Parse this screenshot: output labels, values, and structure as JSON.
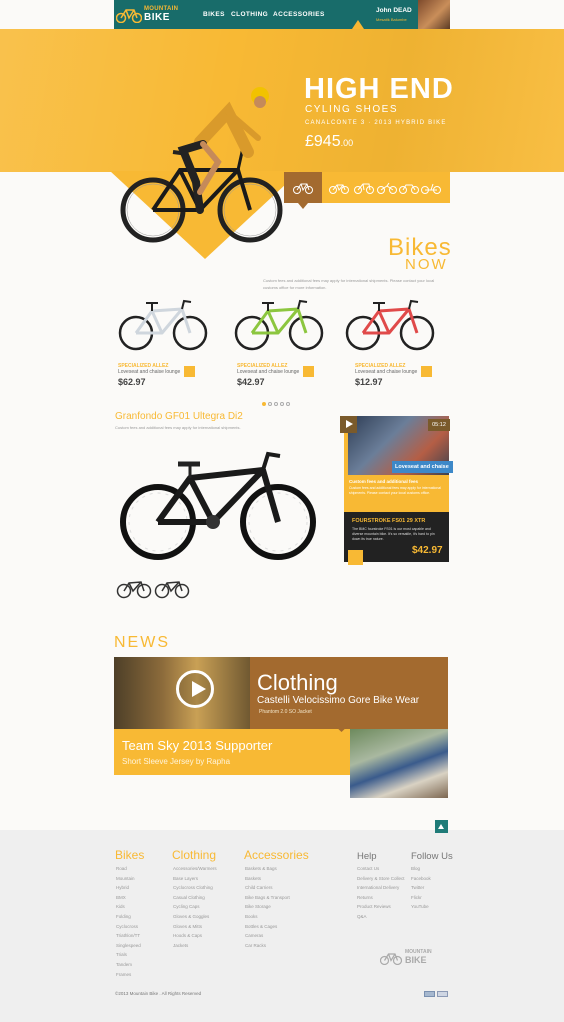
{
  "brand": {
    "line1": "MOUNTAIN",
    "line2": "BIKE"
  },
  "nav": [
    {
      "label": "BIKES"
    },
    {
      "label": "CLOTHING"
    },
    {
      "label": "ACCESSORIES"
    }
  ],
  "user": {
    "name": "John DEAD",
    "subtitle": "Mesatik Balumbe"
  },
  "hero": {
    "title": "HIGH END",
    "subtitle": "CYLING SHOES",
    "model": "CANALCONTE 3 · 2013 HYBRID BIKE",
    "price_main": "£945",
    "price_cents": ".00"
  },
  "bikes_section": {
    "title1": "Bikes",
    "title2": "NOW",
    "desc": "Custom fees and additional fees may apply for international shipments. Please contact your local customs office for more information.",
    "products": [
      {
        "name": "SPECIALIZED ALLEZ",
        "desc": "Loveseat and chaise lounge",
        "price": "$62.97",
        "frame_color": "#cfd6dd"
      },
      {
        "name": "SPECIALIZED ALLEZ",
        "desc": "Loveseat and chaise lounge",
        "price": "$42.97",
        "frame_color": "#8cc63f"
      },
      {
        "name": "SPECIALIZED ALLEZ",
        "desc": "Loveseat and chaise lounge",
        "price": "$12.97",
        "frame_color": "#e04a4a"
      }
    ],
    "active_page": 1
  },
  "featured": {
    "title": "Granfondo GF01 Ultegra Di2",
    "desc": "Custom fees and additional fees may apply for international shipments.",
    "video": {
      "duration": "05:12",
      "label": "Loveseat and chaise",
      "subtitle": "Custom fees and additional fees",
      "subdesc": "Custom fees and additional fees may apply for international shipments. Please contact your local customs office."
    },
    "promo": {
      "title": "FOURSTROKE FS01 29 XTR",
      "desc": "The BMC fourstroke FS01 is our most capable and diverse mountain bike. It's so versatile, it's hard to pin down its true nature.",
      "price": "$42.97"
    }
  },
  "news": {
    "heading": "NEWS",
    "card1": {
      "title": "Clothing",
      "subtitle": "Castelli Velocissimo Gore Bike Wear",
      "note": "Phantom 2.0 SO Jacket"
    },
    "card2": {
      "title": "Team Sky 2013 Supporter",
      "subtitle": "Short Sleeve Jersey by Rapha"
    }
  },
  "footer": {
    "columns": [
      {
        "title": "Bikes",
        "links": [
          "Road",
          "Mountain",
          "Hybrid",
          "BMX",
          "Kids",
          "Folding",
          "Cyclocross",
          "Triathlon/TT",
          "Singlespeed",
          "Trials",
          "Tandem",
          "Frames"
        ]
      },
      {
        "title": "Clothing",
        "links": [
          "Accessories/Warmers",
          "Base Layers",
          "Cyclocross Clothing",
          "Casual Clothing",
          "Cycling Caps",
          "Gloves & Goggles",
          "Gloves & Mitts",
          "Hoods & Caps",
          "Jackets"
        ]
      },
      {
        "title": "Accessories",
        "links": [
          "Baskets & Bags",
          "Baskets",
          "Child Carriers",
          "Bike Bags & Transport",
          "Bike Storage",
          "Books",
          "Bottles & Cages",
          "Cameras",
          "Car Racks"
        ]
      },
      {
        "title": "Help",
        "links": [
          "Contact Us",
          "Delivery & Store Collect",
          "International Delivery",
          "Returns",
          "Product Reviews",
          "Q&A"
        ]
      },
      {
        "title": "Follow Us",
        "links": [
          "Blog",
          "Facebook",
          "Twitter",
          "Flickr",
          "YouTube"
        ]
      }
    ],
    "copyright": "©2013 Mountain Bike . All Rights Reserved",
    "logo1": "MOUNTAIN",
    "logo2": "BIKE"
  },
  "colors": {
    "accent": "#f8b934",
    "header": "#186c6a",
    "brown": "#a36a2f"
  }
}
